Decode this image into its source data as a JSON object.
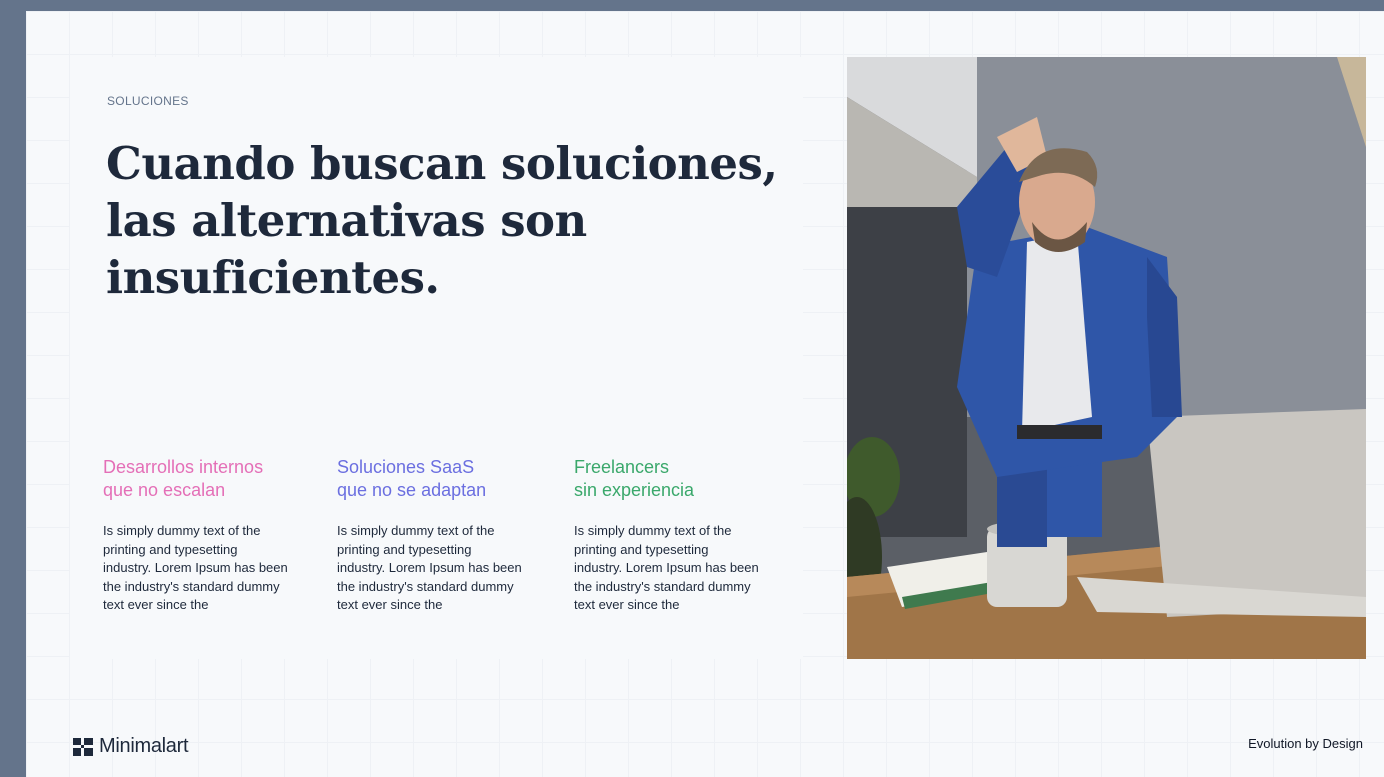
{
  "section": {
    "eyebrow": "SOLUCIONES",
    "headline_line1": "Cuando buscan soluciones,",
    "headline_line2": "las alternativas son",
    "headline_line3": "insuficientes."
  },
  "columns": [
    {
      "title_line1": "Desarrollos internos",
      "title_line2": "que no escalan",
      "color": "#e46fb7",
      "body": "Is simply dummy text of the printing and typesetting industry. Lorem Ipsum has been the industry's standard dummy text ever since the"
    },
    {
      "title_line1": "Soluciones SaaS",
      "title_line2": "que no se adaptan",
      "color": "#6b6fe0",
      "body": "Is simply dummy text of the printing and typesetting industry. Lorem Ipsum has been the industry's standard dummy text ever since the"
    },
    {
      "title_line1": "Freelancers",
      "title_line2": "sin experiencia",
      "color": "#3aa86b",
      "body": "Is simply dummy text of the printing and typesetting industry. Lorem Ipsum has been the industry's standard dummy text ever since the"
    }
  ],
  "photo": {
    "subject": "thoughtful-businessman-at-laptop",
    "colors": {
      "wall": "#8a8f98",
      "suit": "#2f56a8",
      "shirt": "#e8e9ec",
      "desk": "#a07548",
      "laptop": "#c9c6c1"
    }
  },
  "footer": {
    "brand": "Minimalart",
    "tagline": "Evolution by Design"
  }
}
